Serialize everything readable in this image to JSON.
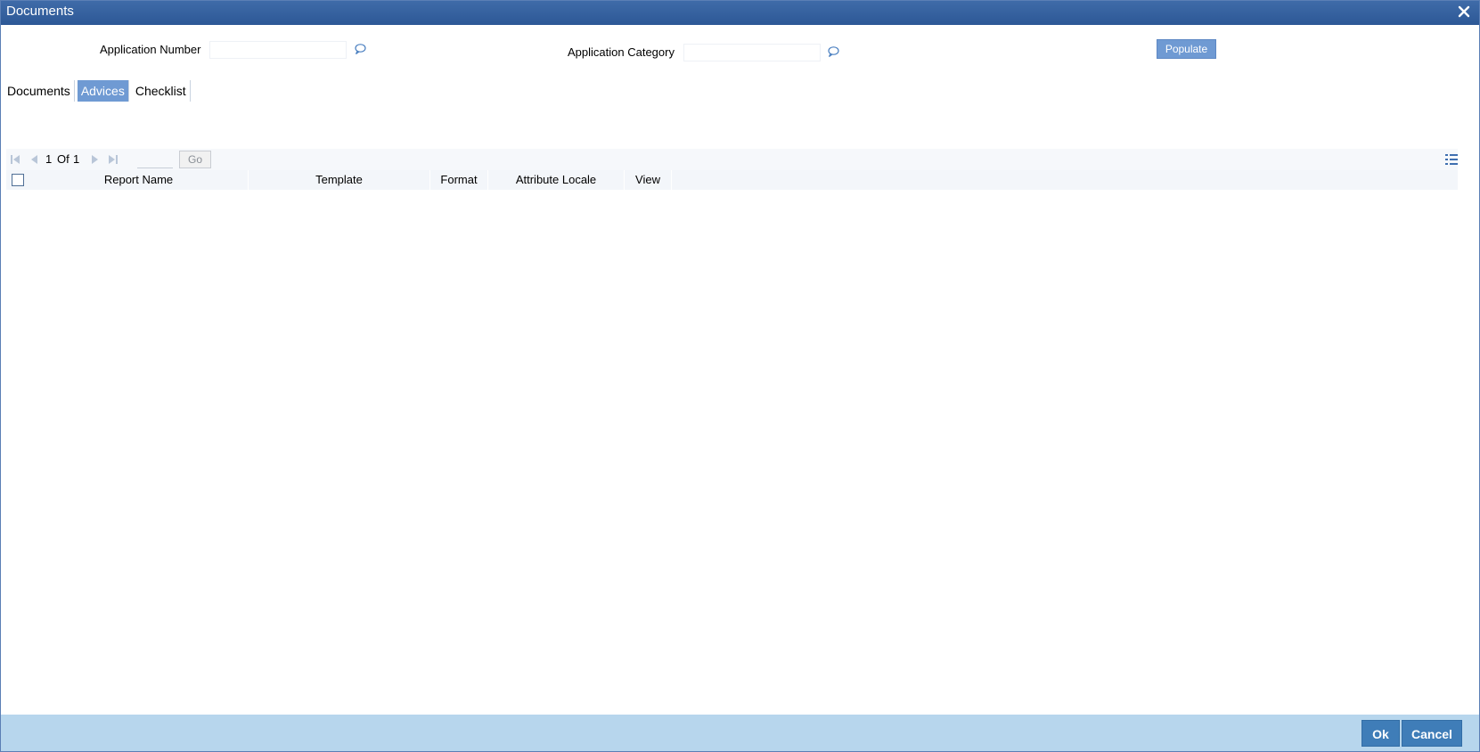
{
  "window": {
    "title": "Documents"
  },
  "form": {
    "application_number_label": "Application Number",
    "application_number_value": "",
    "application_category_label": "Application Category",
    "application_category_value": "",
    "populate_label": "Populate"
  },
  "tabs": [
    {
      "label": "Documents",
      "active": false
    },
    {
      "label": "Advices",
      "active": true
    },
    {
      "label": "Checklist",
      "active": false
    }
  ],
  "pager": {
    "current": "1",
    "of_label": "Of",
    "total": "1",
    "page_input": "",
    "go_label": "Go"
  },
  "table": {
    "columns": [
      "Report Name",
      "Template",
      "Format",
      "Attribute Locale",
      "View"
    ],
    "rows": []
  },
  "footer": {
    "ok_label": "Ok",
    "cancel_label": "Cancel"
  },
  "colors": {
    "title_bar": "#2d5896",
    "accent": "#6f9ad3",
    "footer_bg": "#b7d6ed",
    "footer_button": "#3f7db8"
  }
}
